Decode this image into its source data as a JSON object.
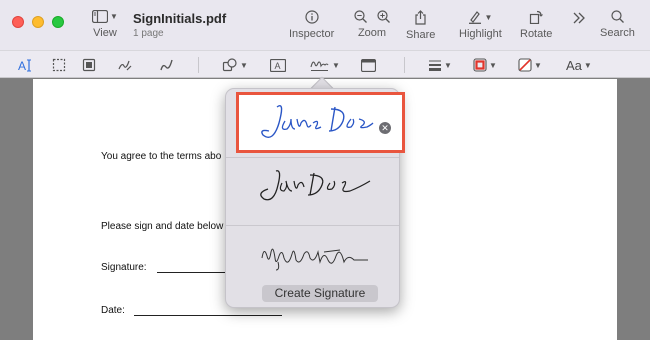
{
  "window": {
    "title": "SignInitials.pdf",
    "subtitle": "1 page"
  },
  "toolbar": {
    "view_label": "View",
    "inspector_label": "Inspector",
    "zoom_label": "Zoom",
    "share_label": "Share",
    "highlight_label": "Highlight",
    "rotate_label": "Rotate",
    "search_label": "Search",
    "more_icon": "chevron-double-right-icon"
  },
  "markup": {
    "tools": [
      "text-selection-icon",
      "rectangular-selection-icon",
      "smart-lasso-icon",
      "sketch-icon",
      "draw-icon",
      "shapes-icon",
      "text-box-icon",
      "sign-icon",
      "note-icon",
      "shape-style-icon",
      "border-color-icon",
      "fill-color-icon",
      "text-style-icon"
    ],
    "text_style_label": "Aa"
  },
  "document": {
    "line1": "You agree to the terms abo",
    "line2": "Please sign and date below",
    "signature_label": "Signature:",
    "date_label": "Date:"
  },
  "signatures": {
    "items": [
      "Jane Doe (typed style)",
      "Jane Doe (handwritten)",
      "My signature (handwritten)"
    ],
    "selected_index": 0,
    "create_label": "Create Signature"
  },
  "colors": {
    "accent": "#2f6fde",
    "highlight_border": "#e9553e",
    "signature_blue": "#2a56c6"
  }
}
